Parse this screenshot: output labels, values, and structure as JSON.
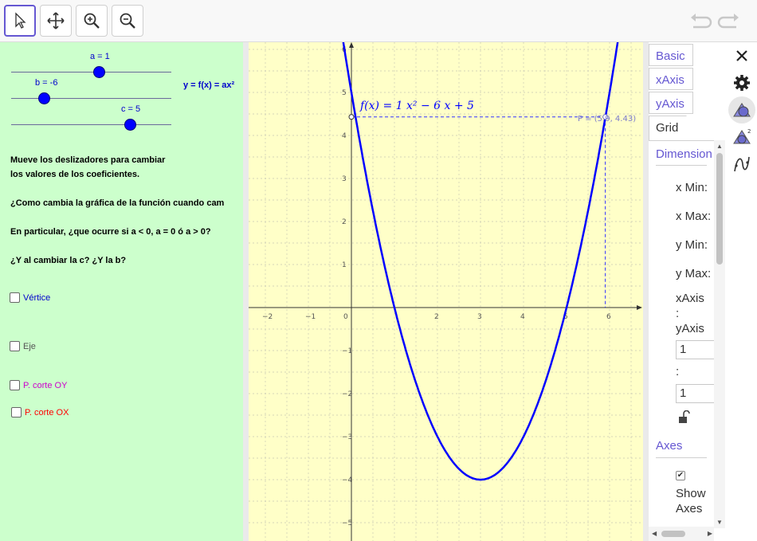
{
  "toolbar": {
    "tools": [
      {
        "name": "move-tool",
        "icon": "cursor-arrow-icon",
        "active": true
      },
      {
        "name": "move-graphics-tool",
        "icon": "four-arrows-icon"
      },
      {
        "name": "zoom-in-tool",
        "icon": "zoom-in-icon"
      },
      {
        "name": "zoom-out-tool",
        "icon": "zoom-out-icon"
      }
    ],
    "undo_icon": "undo-icon",
    "redo_icon": "redo-icon"
  },
  "sliders": [
    {
      "label": "a = 1",
      "value": 1
    },
    {
      "label": "b = -6",
      "value": -6
    },
    {
      "label": "c = 5",
      "value": 5
    }
  ],
  "function_label": "y = f(x) = ax²",
  "instructions": {
    "line1": "Mueve los deslizadores para cambiar",
    "line2": "los valores de los coeficientes.",
    "line3": "¿Como cambia la gráfica de la función cuando cam",
    "line4": "En particular, ¿que ocurre si a < 0, a = 0 ó a > 0?",
    "line5": "¿Y al cambiar la c? ¿Y la b?"
  },
  "checkboxes": [
    {
      "label": "Vértice",
      "color": "#0000cc",
      "checked": false
    },
    {
      "label": "Eje",
      "color": "#555555",
      "checked": false
    },
    {
      "label": "P. corte OY",
      "color": "#cc00cc",
      "checked": false
    },
    {
      "label": "P. corte OX",
      "color": "#ff0000",
      "checked": false
    }
  ],
  "graph": {
    "function_text": "f(x)  =  1 x² − 6 x + 5",
    "point_label": "P = (5.9, 4.43)",
    "x_ticks": [
      "−2",
      "−1",
      "0",
      "2",
      "3",
      "4",
      "5",
      "6"
    ],
    "y_ticks": [
      "6",
      "5",
      "4",
      "3",
      "2",
      "1",
      "−1",
      "−2",
      "−3",
      "−4",
      "−5"
    ],
    "curve_color": "#0000ff",
    "background": "#ffffc8"
  },
  "properties": {
    "tabs": [
      "Basic",
      "xAxis",
      "yAxis",
      "Grid"
    ],
    "selected_tab": "Grid",
    "dimensions_title": "Dimension",
    "x_min_label": "x Min:",
    "x_max_label": "x Max:",
    "y_min_label": "y Min:",
    "y_max_label": "y Max:",
    "ratio_label_1": "xAxis",
    "ratio_label_2": ":",
    "ratio_label_3": "yAxis",
    "ratio_value_1": "1",
    "ratio_colon": ":",
    "ratio_value_2": "1",
    "axes_title": "Axes",
    "show_axes_1": "Show",
    "show_axes_2": "Axes",
    "show_axes_checked": true
  },
  "side_icons": [
    "close-icon",
    "gear-icon",
    "graphics-style-icon",
    "graphics2-style-icon",
    "curve-icon"
  ]
}
